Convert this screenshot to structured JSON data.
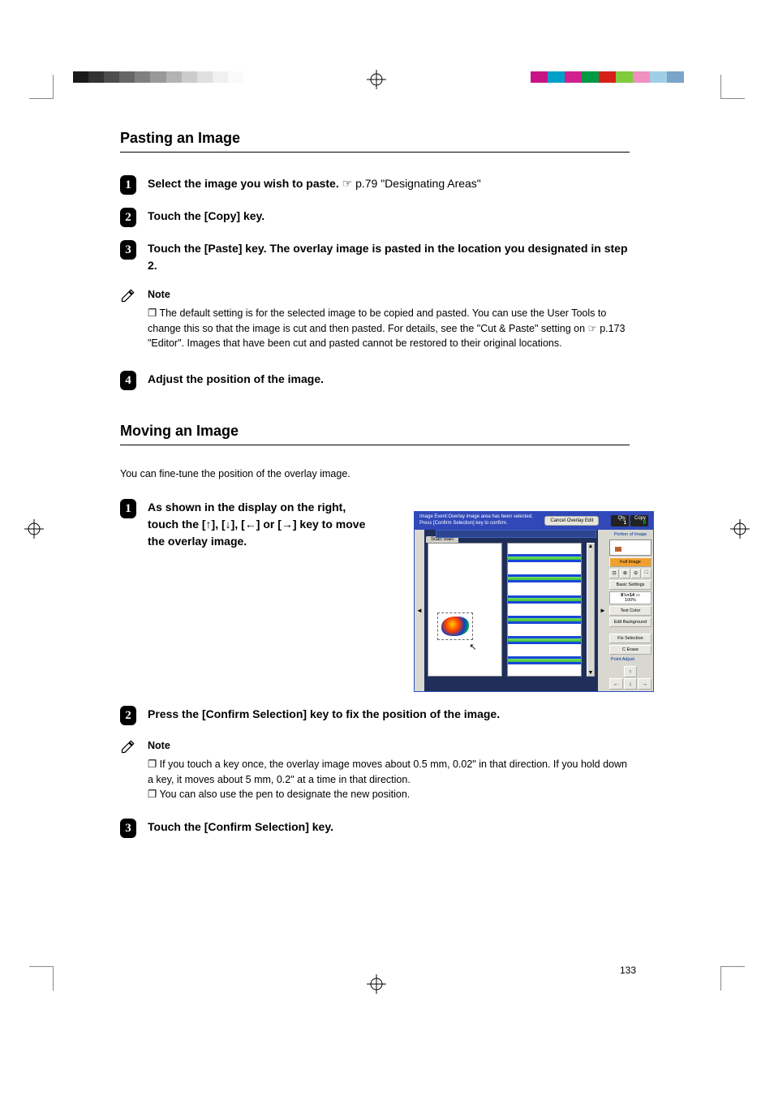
{
  "section1": {
    "heading": "Pasting an Image",
    "steps": [
      {
        "num": "1",
        "prefix": "Select the image you wish to paste. ",
        "ref": "☞ p.79 \"Designating Areas\""
      },
      {
        "num": "2",
        "prefix": "Touch the ",
        "bold": "[Copy]",
        "suffix": " key."
      },
      {
        "num": "3",
        "prefix": "Touch the ",
        "bold": "[Paste]",
        "suffix": " key. The overlay image is pasted in the location you designated in step 2."
      }
    ],
    "note": {
      "label": "Note",
      "lines": [
        "❐  The default setting is for the selected image to be copied and pasted. You can use the User Tools to change this so that the image is cut and then pasted. For details, see the \"Cut & Paste\" setting on  ☞ p.173 \"Editor\". Images that have been cut and pasted cannot be restored to their original locations."
      ]
    },
    "step4": {
      "num": "4",
      "text": "Adjust the position of the image."
    }
  },
  "section2": {
    "heading": "Moving an Image",
    "intro": "You can fine-tune the position of the overlay image.",
    "step1": {
      "num": "1",
      "text_prefix": "As shown in the display on the right, touch the ",
      "bold1": "[↑]",
      "mid1": ", ",
      "bold2": "[↓]",
      "mid2": ", ",
      "bold3": "[←]",
      "mid3": " or ",
      "bold4": "[→]",
      "text_suffix": " key to move the overlay image."
    },
    "step2": {
      "num": "2",
      "prefix": "Press the ",
      "bold": "[Confirm Selection]",
      "suffix": " key to fix the position of the image."
    },
    "note": {
      "label": "Note",
      "lines": [
        "❐  If you touch a key once, the overlay image moves about 0.5 mm, 0.02\" in that direction. If you hold down a key, it moves about 5 mm, 0.2\" at a time in that direction.",
        "❐  You can also use the pen to designate the new position."
      ]
    },
    "step3": {
      "num": "3",
      "prefix": "Touch the ",
      "bold": "[Confirm Selection]",
      "suffix": " key."
    }
  },
  "screenshot": {
    "top_line1": "Image Event:Overlay image area has been selected.",
    "top_line2": "Press [Confirm Selection] key to confirm.",
    "cancel": "Cancel Overlay Edit",
    "qty_label": "Qty.",
    "qty_val": "1",
    "copy_label": "Copy",
    "copy_val": "0",
    "portion_label": "Portion of Image",
    "tab": "Scan Start",
    "full_image": "Full Image",
    "basic_settings": "Basic Settings",
    "paper": "8½×14",
    "paper_pct": "100%",
    "text_color": "Text Color",
    "edit_bg": "Edit Background",
    "fix_sel": "Fix Selection",
    "erase": "C Erase",
    "point_adjust": "Point Adjust"
  },
  "page_number": "133",
  "gray_shades": [
    "#1a1a1a",
    "#333",
    "#4d4d4d",
    "#666",
    "#808080",
    "#999",
    "#b3b3b3",
    "#ccc",
    "#e0e0e0",
    "#f0f0f0",
    "#fafafa"
  ],
  "color_swatches": [
    "#c71585",
    "#00a0c8",
    "#d02090",
    "#009944",
    "#d8201a",
    "#7fcb3b",
    "#f08fc0",
    "#9fcfe6",
    "#7aa4c8",
    "#ffffff"
  ]
}
